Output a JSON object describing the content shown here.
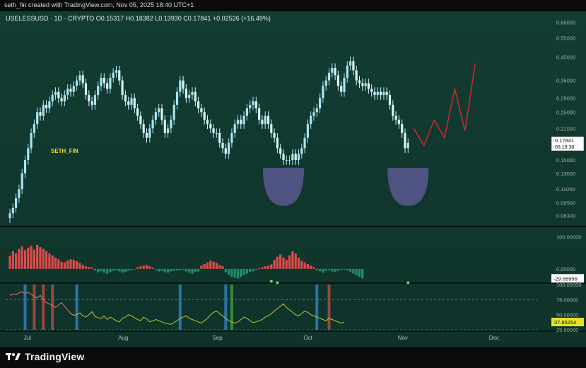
{
  "header": {
    "credit": "seth_fin created with TradingView.com, Nov 05, 2025 18:40 UTC+1",
    "symbol_line": "USELESSUSD · 1D · CRYPTO  O0.15317  H0.18382  L0.13930  C0.17841  +0.02526 (+16.49%)"
  },
  "annotation": {
    "label": "SETH_FIN",
    "color": "#e4e324"
  },
  "brand": {
    "name": "TradingView"
  },
  "colors": {
    "up": "#a8e4f0",
    "down": "#d9f2f6",
    "hist_pos": "#e04a4a",
    "hist_neg": "#1f8f6a",
    "projection": "#d8262a",
    "bowl": "#5a5891",
    "osc_line": "#c8c23a",
    "osc_upper_line": "#d65d5d",
    "bar_blue": "#2f7fbf",
    "bar_red": "#b34a44",
    "bar_green": "#3d9a3d"
  },
  "chart_data": [
    {
      "type": "candlestick",
      "scale": "log",
      "y_ticks": [
        "0.65000",
        "0.55000",
        "0.45000",
        "0.35000",
        "0.29000",
        "0.25000",
        "0.21000",
        "0.17841",
        "0.15000",
        "0.13000",
        "0.11000",
        "0.09500",
        "0.08300"
      ],
      "price_ticks": [
        0.65,
        0.55,
        0.45,
        0.35,
        0.29,
        0.25,
        0.21,
        0.15,
        0.13,
        0.11,
        0.095,
        0.083
      ],
      "ylim": [
        0.075,
        0.72
      ],
      "x_labels": [
        "Jul",
        "Aug",
        "Sep",
        "Oct",
        "Nov",
        "Dec"
      ],
      "x_label_index": [
        6,
        37,
        68,
        98,
        129,
        159
      ],
      "last_price": "0.17841",
      "countdown": "06:19:38",
      "closes": [
        0.085,
        0.09,
        0.1,
        0.11,
        0.13,
        0.15,
        0.17,
        0.2,
        0.22,
        0.25,
        0.24,
        0.27,
        0.26,
        0.28,
        0.3,
        0.31,
        0.29,
        0.28,
        0.3,
        0.32,
        0.31,
        0.33,
        0.35,
        0.37,
        0.34,
        0.3,
        0.28,
        0.27,
        0.3,
        0.33,
        0.36,
        0.34,
        0.32,
        0.36,
        0.38,
        0.39,
        0.35,
        0.3,
        0.28,
        0.27,
        0.29,
        0.26,
        0.24,
        0.22,
        0.2,
        0.19,
        0.21,
        0.23,
        0.25,
        0.26,
        0.23,
        0.2,
        0.21,
        0.23,
        0.27,
        0.31,
        0.35,
        0.32,
        0.29,
        0.3,
        0.31,
        0.28,
        0.26,
        0.25,
        0.23,
        0.22,
        0.21,
        0.2,
        0.2,
        0.18,
        0.17,
        0.16,
        0.18,
        0.2,
        0.22,
        0.23,
        0.22,
        0.24,
        0.26,
        0.27,
        0.28,
        0.26,
        0.23,
        0.22,
        0.24,
        0.22,
        0.2,
        0.19,
        0.17,
        0.16,
        0.15,
        0.15,
        0.15,
        0.16,
        0.15,
        0.16,
        0.17,
        0.19,
        0.22,
        0.24,
        0.25,
        0.26,
        0.29,
        0.33,
        0.35,
        0.38,
        0.4,
        0.37,
        0.33,
        0.31,
        0.36,
        0.41,
        0.43,
        0.39,
        0.35,
        0.34,
        0.33,
        0.34,
        0.32,
        0.31,
        0.3,
        0.31,
        0.3,
        0.31,
        0.3,
        0.27,
        0.24,
        0.23,
        0.22,
        0.2,
        0.17,
        0.18
      ],
      "projection": [
        [
          0.18,
          0.21
        ],
        [
          0.19,
          0.175
        ],
        [
          0.2,
          0.23
        ],
        [
          0.21,
          0.19
        ],
        [
          0.22,
          0.32
        ],
        [
          0.23,
          0.205
        ],
        [
          0.24,
          0.42
        ]
      ]
    },
    {
      "type": "bar",
      "name": "histogram",
      "y_ticks": [
        "100.00000",
        "0.00000",
        "-29.65956"
      ],
      "ylim": [
        -40,
        110
      ],
      "values": [
        40,
        55,
        48,
        62,
        70,
        58,
        66,
        72,
        60,
        75,
        68,
        62,
        55,
        48,
        42,
        35,
        30,
        22,
        20,
        26,
        30,
        28,
        24,
        18,
        12,
        8,
        6,
        4,
        -5,
        -10,
        -8,
        -12,
        -15,
        -10,
        -6,
        -4,
        -8,
        -12,
        -10,
        -6,
        -4,
        -2,
        5,
        8,
        10,
        12,
        8,
        4,
        -4,
        -8,
        -6,
        -10,
        -12,
        -8,
        -6,
        -5,
        -4,
        -3,
        -8,
        -12,
        -15,
        -10,
        -8,
        10,
        15,
        20,
        25,
        22,
        18,
        12,
        8,
        -10,
        -18,
        -25,
        -28,
        -30,
        -26,
        -20,
        -15,
        -10,
        -8,
        -4,
        2,
        5,
        8,
        10,
        14,
        28,
        38,
        45,
        35,
        28,
        42,
        55,
        48,
        35,
        25,
        20,
        15,
        10,
        5,
        -5,
        -8,
        -12,
        -6,
        -4,
        -8,
        -10,
        -6,
        -4,
        -2,
        -5,
        -10,
        -15,
        -20,
        -25,
        -29.66
      ]
    },
    {
      "type": "line",
      "name": "oscillator",
      "y_ticks": [
        "100.00000",
        "75.00000",
        "50.00000",
        "37.85254",
        "25.00000"
      ],
      "ylim": [
        25,
        100
      ],
      "values": [
        82,
        84,
        83,
        86,
        88,
        85,
        87,
        84,
        80,
        78,
        82,
        75,
        70,
        68,
        65,
        62,
        66,
        70,
        64,
        58,
        52,
        49,
        50,
        53,
        48,
        46,
        50,
        55,
        47,
        45,
        44,
        48,
        42,
        46,
        43,
        40,
        38,
        44,
        46,
        50,
        48,
        45,
        42,
        40,
        46,
        43,
        38,
        40,
        42,
        40,
        38,
        36,
        35,
        34,
        37,
        40,
        44,
        46,
        48,
        44,
        42,
        40,
        38,
        36,
        40,
        44,
        50,
        54,
        56,
        52,
        48,
        44,
        40,
        38,
        36,
        38,
        42,
        46,
        44,
        40,
        37,
        38,
        40,
        42,
        46,
        48,
        52,
        56,
        60,
        64,
        68,
        62,
        58,
        54,
        50,
        48,
        52,
        56,
        54,
        50,
        48,
        46,
        44,
        42,
        40,
        44,
        42,
        40,
        38,
        36,
        37.85
      ],
      "upper_values": [
        82,
        84,
        83,
        86,
        88,
        85,
        87,
        84,
        80,
        78,
        82,
        75,
        70,
        68,
        65,
        62,
        66,
        70,
        64,
        58,
        52
      ],
      "vertical_bars": [
        {
          "i": 5,
          "color": "blue"
        },
        {
          "i": 8,
          "color": "red"
        },
        {
          "i": 11,
          "color": "red"
        },
        {
          "i": 14,
          "color": "red"
        },
        {
          "i": 22,
          "color": "blue"
        },
        {
          "i": 56,
          "color": "blue"
        },
        {
          "i": 71,
          "color": "blue"
        },
        {
          "i": 73,
          "color": "green"
        },
        {
          "i": 101,
          "color": "blue"
        },
        {
          "i": 105,
          "color": "red"
        }
      ]
    }
  ]
}
